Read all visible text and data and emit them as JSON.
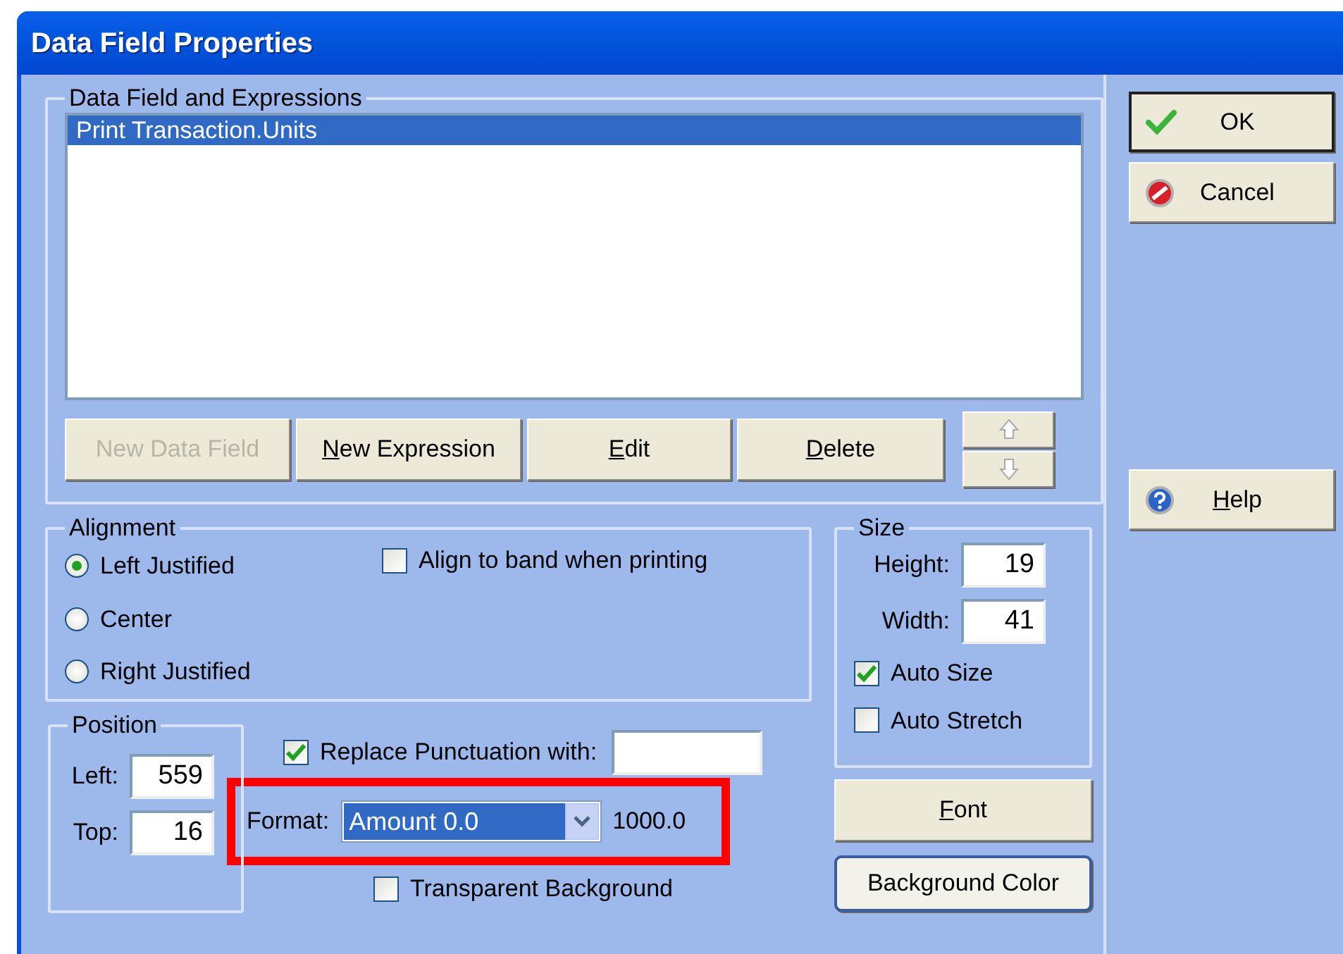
{
  "window": {
    "title": "Data Field Properties"
  },
  "data_fields": {
    "legend": "Data Field and Expressions",
    "items": [
      {
        "label": "Print Transaction.Units",
        "selected": true
      }
    ],
    "buttons": [
      {
        "label": "New Data Field",
        "disabled": true,
        "mnemonic": false
      },
      {
        "label": "New Expression",
        "disabled": false,
        "mnemonic": true
      },
      {
        "label": "Edit",
        "disabled": false,
        "mnemonic": true
      },
      {
        "label": "Delete",
        "disabled": false,
        "mnemonic": true
      }
    ]
  },
  "alignment": {
    "legend": "Alignment",
    "options": [
      {
        "label": "Left Justified",
        "selected": true
      },
      {
        "label": "Center",
        "selected": false
      },
      {
        "label": "Right Justified",
        "selected": false
      }
    ],
    "align_to_band": {
      "label": "Align to band when printing",
      "checked": false
    }
  },
  "size": {
    "legend": "Size",
    "fields": [
      {
        "label": "Height:",
        "value": "19"
      },
      {
        "label": "Width:",
        "value": "41"
      }
    ],
    "checks": [
      {
        "label": "Auto Size",
        "checked": true
      },
      {
        "label": "Auto Stretch",
        "checked": false
      }
    ]
  },
  "position": {
    "legend": "Position",
    "fields": [
      {
        "label": "Left:",
        "value": "559"
      },
      {
        "label": "Top:",
        "value": "16"
      }
    ]
  },
  "replace_punctuation": {
    "label": "Replace Punctuation with:",
    "checked": true
  },
  "format": {
    "label": "Format:",
    "value": "Amount 0.0",
    "preview": "1000.0",
    "highlighted": true
  },
  "transparent_background": {
    "label": "Transparent Background",
    "checked": false
  },
  "style_buttons": [
    {
      "label": "Font",
      "mnemonic": true,
      "focused": false
    },
    {
      "label": "Background Color",
      "mnemonic": false,
      "focused": true
    }
  ],
  "dialog_buttons": [
    {
      "kind": "ok",
      "label": "OK",
      "mnemonic": false,
      "default": true
    },
    {
      "kind": "cancel",
      "label": "Cancel",
      "mnemonic": false,
      "default": false
    },
    {
      "kind": "help",
      "label": "Help",
      "mnemonic": true,
      "default": false
    }
  ]
}
